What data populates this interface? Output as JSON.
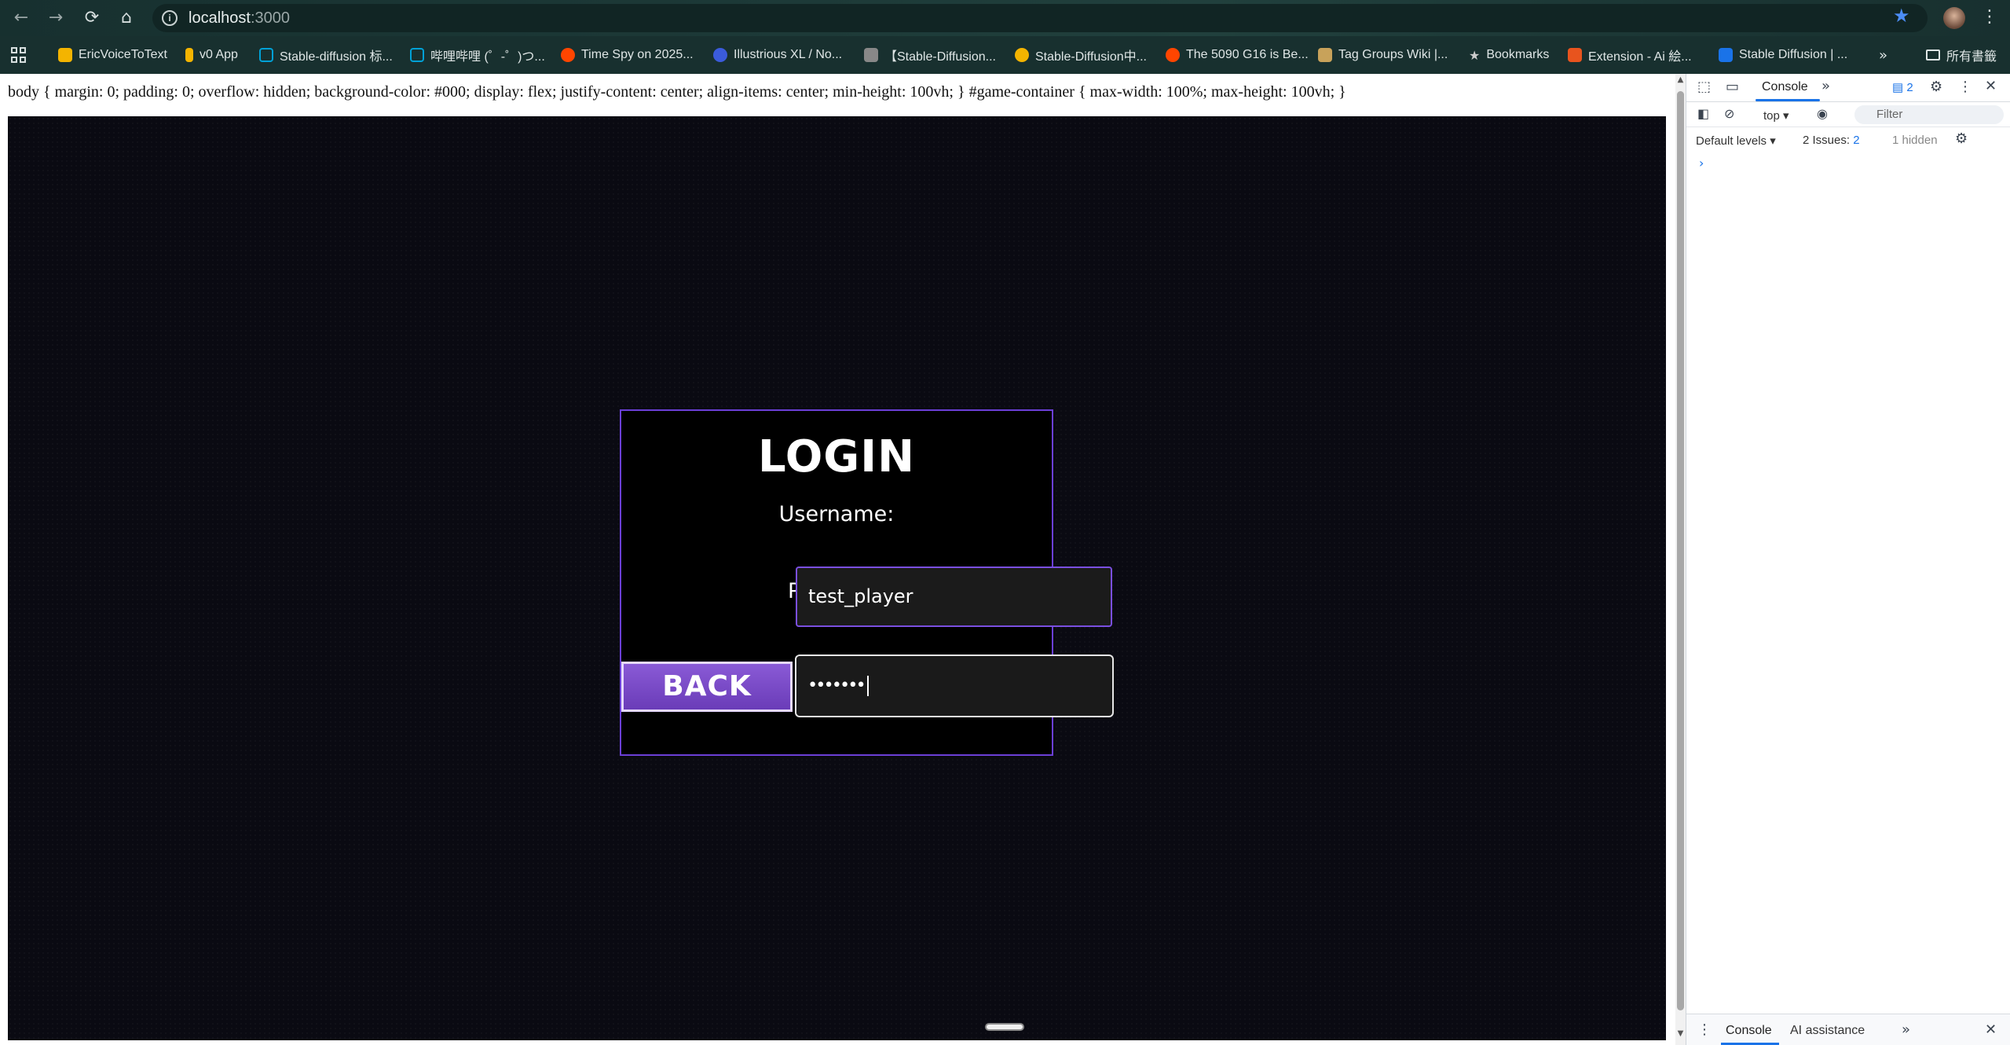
{
  "browser": {
    "url_host": "localhost",
    "url_port": ":3000",
    "bookmarks": [
      {
        "label": "EricVoiceToText",
        "color": "#f4b400"
      },
      {
        "label": "v0 App",
        "color": "#f4b400"
      },
      {
        "label": "Stable-diffusion 标...",
        "color": "#00a1d6"
      },
      {
        "label": "哔哩哔哩 (゜-゜)つ...",
        "color": "#00a1d6"
      },
      {
        "label": "Time Spy on 2025...",
        "color": "#ff4500"
      },
      {
        "label": "Illustrious XL / No...",
        "color": "#3b5bdb"
      },
      {
        "label": "【Stable-Diffusion...",
        "color": "#888888"
      },
      {
        "label": "Stable-Diffusion中...",
        "color": "#f4b400"
      },
      {
        "label": "The 5090 G16 is Be...",
        "color": "#ff4500"
      },
      {
        "label": "Tag Groups Wiki |...",
        "color": "#c8a25a"
      },
      {
        "label": "Bookmarks",
        "color": "#cccccc"
      },
      {
        "label": "Extension - Ai 絵...",
        "color": "#e8541e"
      },
      {
        "label": "Stable Diffusion | ...",
        "color": "#1a73e8"
      }
    ],
    "all_bookmarks_label": "所有書籤"
  },
  "page": {
    "css_text": "body { margin: 0; padding: 0; overflow: hidden; background-color: #000; display: flex; justify-content: center; align-items: center; min-height: 100vh; } #game-container { max-width: 100%; max-height: 100vh; }"
  },
  "login": {
    "title": "LOGIN",
    "username_label": "Username:",
    "password_label_partial": "P",
    "username_value": "test_player",
    "password_value": "•••••••",
    "back_label": "BACK",
    "accent_color": "#6b3fd6"
  },
  "devtools": {
    "tab_console": "Console",
    "badge_count": "2",
    "context": "top",
    "filter_placeholder": "Filter",
    "levels": "Default levels",
    "issues_label": "2 Issues:",
    "issues_count": "2",
    "hidden_label": "1 hidden",
    "bottom_console": "Console",
    "bottom_ai": "AI assistance"
  }
}
